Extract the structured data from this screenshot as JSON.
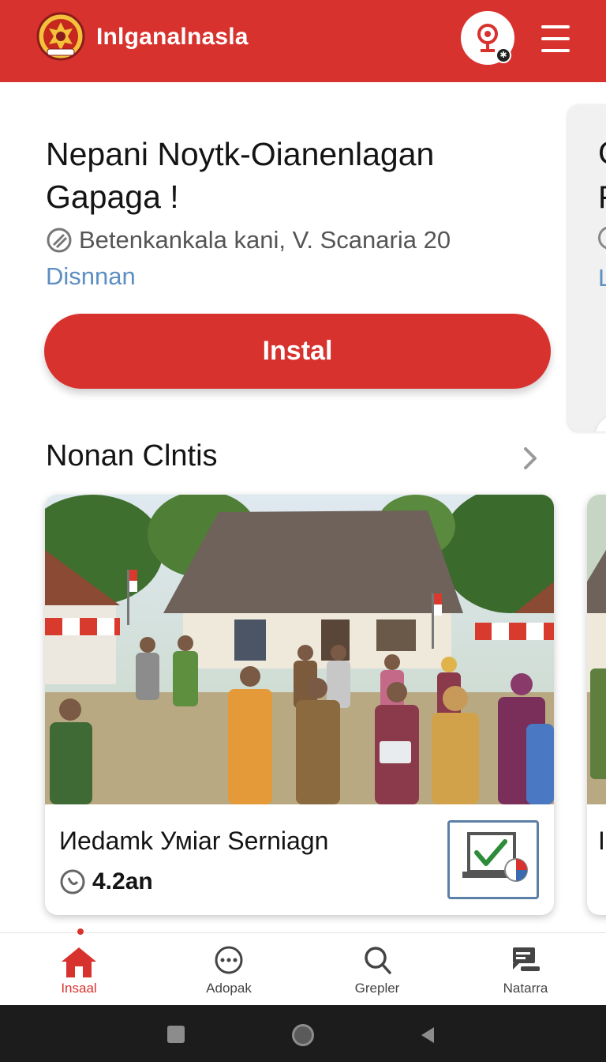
{
  "header": {
    "app_title": "Inlganalnasla",
    "logo": "garuda-emblem-icon",
    "profile_icon": "location-pin-icon",
    "menu_icon": "hamburger-menu-icon"
  },
  "featured": {
    "title_line1": "Nepani Νoytk-Oianenlagan",
    "title_line2": "Gapaga !",
    "meta": "Betenkankala kani, V. Scanaria 20",
    "link": "Disnnan",
    "install_label": "Instal"
  },
  "peek_card": {
    "text1": "C",
    "text2": "F",
    "link": "L"
  },
  "section": {
    "title": "Nonan Clntis"
  },
  "news": {
    "title": "Иedamk Уміar Serniagn",
    "stat": "4.2an",
    "peek_text": "I"
  },
  "bottom_nav": {
    "items": [
      {
        "label": "Insaal",
        "icon": "home-icon",
        "active": true
      },
      {
        "label": "Adopak",
        "icon": "more-circle-icon",
        "active": false
      },
      {
        "label": "Grepler",
        "icon": "search-icon",
        "active": false
      },
      {
        "label": "Natarra",
        "icon": "chat-icon",
        "active": false
      }
    ]
  },
  "colors": {
    "brand": "#d8322e",
    "link": "#5d8fc2",
    "thumb_border": "#5b7fa6"
  }
}
